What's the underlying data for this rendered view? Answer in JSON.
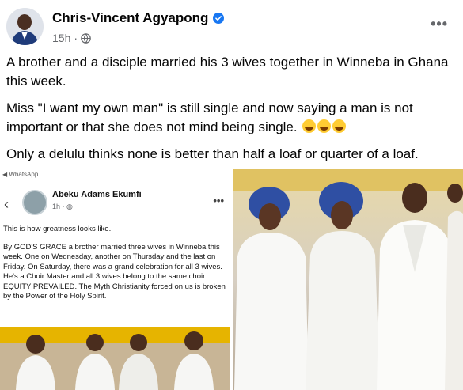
{
  "post": {
    "author": "Chris-Vincent Agyapong",
    "time": "15h",
    "privacy_icon": "globe-icon",
    "verified_icon": "verified-badge-icon",
    "more_label": "•••",
    "paragraphs": [
      "A brother and a disciple married his 3 wives together in Winneba in Ghana this week.",
      "Miss \"I want my own man\" is still single and now saying a man is not important or that she does not mind being single.",
      "Only a delulu thinks none is better than half a loaf or quarter of a loaf."
    ],
    "emoji_icon": "rolling-laughing-emoji-icon"
  },
  "shared": {
    "app_label": "◀ WhatsApp",
    "back_icon": "back-chevron-icon",
    "author": "Abeku Adams Ekumfi",
    "time": "1h · ",
    "more_label": "•••",
    "text1": "This is how greatness looks like.",
    "text2": "By GOD'S GRACE a brother married three wives in Winneba this week. One on Wednesday, another on Thursday and the last on Friday. On Saturday, there was a grand celebration for all 3 wives. He's a Choir Master and all 3 wives belong to the same choir. EQUITY PREVAILED. The Myth Christianity forced on us is broken by the Power of the Holy Spirit."
  },
  "colors": {
    "verified": "#1877f2",
    "meta": "#65676b",
    "white_dress": "#f8f8f6",
    "headwrap": "#2f4fa3"
  }
}
